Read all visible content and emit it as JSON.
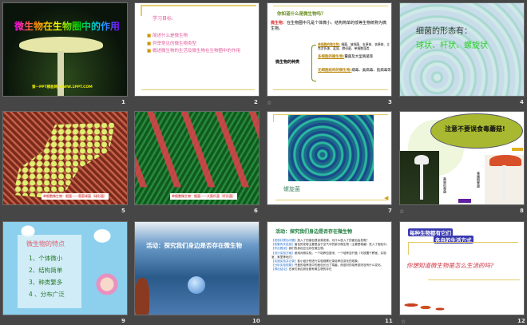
{
  "slides": [
    {
      "number": "1",
      "title": "微生物在生物圈中的作用",
      "footer": "第一PPT模板网-WWW.1PPT.COM"
    },
    {
      "number": "2",
      "heading": "学习目标:",
      "bullets": [
        "简述什么是微生物",
        "列举常见的微生物类型",
        "概述微生物的生活及微生物在生物圈中的作用"
      ]
    },
    {
      "number": "3",
      "heading": "你知道什么是微生物吗？",
      "def_label": "微生物：",
      "def_text": "在生物圈中凡是个体微小、结构简单的低等生物统称为微生物。",
      "types_label": "微生物的种类",
      "types": [
        {
          "name": "单细胞的微生物:",
          "desc": "细菌、放线菌、支原体、衣原体、立克次氏体、蓝藻、酵母菌、单细胞藻类"
        },
        {
          "name": "多细胞的微生物:",
          "desc": "霉菌及大型真菌等"
        },
        {
          "name": "无细胞结构的微生物:",
          "desc": "病毒、类病毒、朊病毒等"
        }
      ]
    },
    {
      "number": "4",
      "line1": "细菌的形态有：",
      "line2": "球状、杆状、螺旋状"
    },
    {
      "number": "5",
      "caption": "单细胞微生物：细菌——葡萄球菌（球形菌）"
    },
    {
      "number": "6",
      "caption": "单细胞微生物：细菌——大肠杆菌（杆形菌）"
    },
    {
      "number": "7",
      "caption": "螺旋菌"
    },
    {
      "number": "8",
      "bubble": "注意不要误食毒蘑菇!",
      "label_left": "美丽的毒菌",
      "label_right": "毒蝇鹅膏菌"
    },
    {
      "number": "9",
      "heading": "微生物的特点",
      "items": [
        "1、个体微小",
        "2、结构简单",
        "3、种类繁多",
        "4 、分布广泛"
      ]
    },
    {
      "number": "10",
      "title": "活动：探究我们身边是否存在微生物"
    },
    {
      "number": "11",
      "heading": "活动：探究我们身边是否存在微生物",
      "steps": [
        {
          "tag": "【发现并提出问题】",
          "text": "放入了的面包很容易发霉，为什么放入了的面包会发霉？"
        },
        {
          "tag": "【收集有关信息】",
          "text": "面包的发霉主要是由于空气中的部分微生物（主要是霉菌）进入了面包中。"
        },
        {
          "tag": "【作出假设】",
          "text": "我们的身边应当存在微生物。"
        },
        {
          "tag": "【设计实验方案】",
          "text": "使用对照实验，一个培养皿密闭，一个培养皿开盖（可放置于教室、实验室、家里等地方）"
        },
        {
          "tag": "【实施实验并记录】",
          "text": "各小组分别进行实验观察记录培养皿变化的现象。"
        },
        {
          "tag": "【分析实验现象】",
          "text": "开盖的培养皿中的面包长出了霉菌，而密封的培养皿则没有什么变化。"
        },
        {
          "tag": "【得出结论】",
          "text": "在我们身边到处都有微生物的存在"
        }
      ]
    },
    {
      "number": "12",
      "line1": "每种生物都有它们",
      "line2": "各自的生活方式",
      "question": "你想知道微生物是怎么生活的吗?"
    }
  ],
  "animation_icon_label": "动画"
}
